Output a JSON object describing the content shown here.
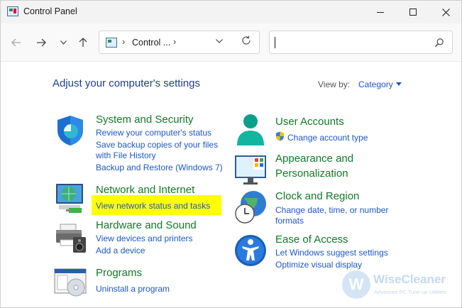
{
  "window": {
    "title": "Control Panel"
  },
  "address_bar": {
    "path": "Control ...",
    "search_value": ""
  },
  "header": {
    "title": "Adjust your computer's settings",
    "view_by_label": "View by:",
    "view_by_value": "Category"
  },
  "categories": {
    "system_security": {
      "title": "System and Security",
      "links": [
        "Review your computer's status",
        "Save backup copies of your files",
        "with File History",
        "Backup and Restore (Windows 7)"
      ]
    },
    "network_internet": {
      "title": "Network and Internet",
      "links": [
        "View network status and tasks"
      ]
    },
    "hardware_sound": {
      "title": "Hardware and Sound",
      "links": [
        "View devices and printers",
        "Add a device"
      ]
    },
    "programs": {
      "title": "Programs",
      "links": [
        "Uninstall a program"
      ]
    },
    "user_accounts": {
      "title": "User Accounts",
      "links": [
        "Change account type"
      ]
    },
    "appearance": {
      "title_line1": "Appearance and",
      "title_line2": "Personalization"
    },
    "clock_region": {
      "title": "Clock and Region",
      "links": [
        "Change date, time, or number",
        "formats"
      ]
    },
    "ease_access": {
      "title": "Ease of Access",
      "links": [
        "Let Windows suggest settings",
        "Optimize visual display"
      ]
    }
  },
  "watermark": {
    "title": "WiseCleaner",
    "subtitle": "Advanced PC Tune-up Utilities",
    "letter": "W"
  },
  "colors": {
    "category_title": "#117a26",
    "link": "#1e57c6",
    "heading": "#1e3f8f",
    "highlight": "#ffff00"
  }
}
